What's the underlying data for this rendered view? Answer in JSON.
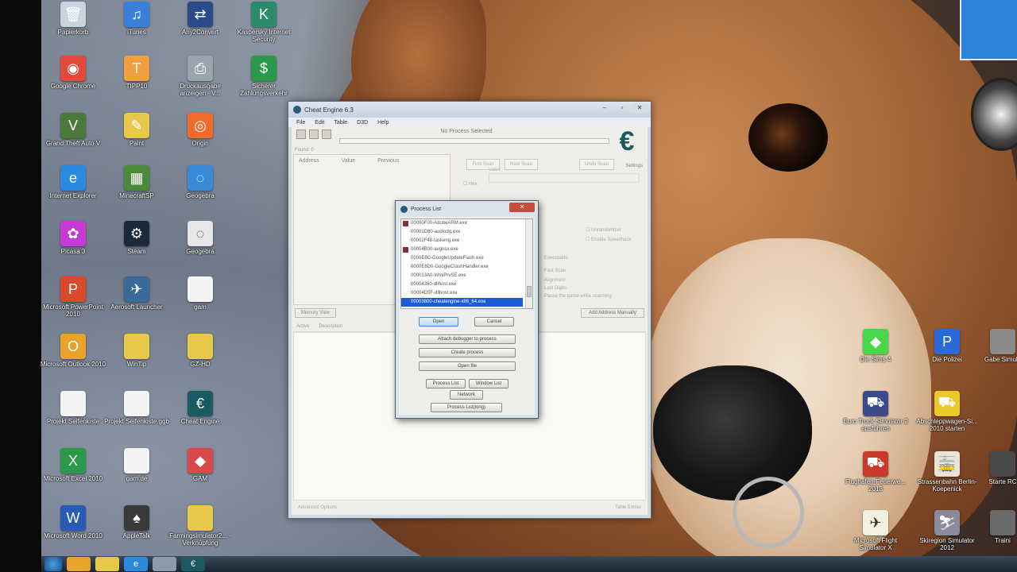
{
  "desktop_icons": [
    {
      "label": "Papierkorb",
      "icon": "recycle-bin-icon",
      "color": "#c9d4de",
      "glyph": "🗑"
    },
    {
      "label": "iTunes",
      "icon": "itunes-icon",
      "color": "#3a7fd8",
      "glyph": "♫"
    },
    {
      "label": "Any2Convert",
      "icon": "converter-icon",
      "color": "#2a4a8a",
      "glyph": "⇄"
    },
    {
      "label": "Kaspersky Internet Security",
      "icon": "kaspersky-icon",
      "color": "#2a8a6a",
      "glyph": "K"
    },
    {
      "label": "Google Chrome",
      "icon": "chrome-icon",
      "color": "#e24a3a",
      "glyph": "◉"
    },
    {
      "label": "TIPP10",
      "icon": "tipp10-icon",
      "color": "#f0a040",
      "glyph": "T"
    },
    {
      "label": "Druckausgabe anzeigen - V...",
      "icon": "printer-icon",
      "color": "#9aa4ac",
      "glyph": "⎙"
    },
    {
      "label": "Sicherer Zahlungsverkehr",
      "icon": "secure-payment-icon",
      "color": "#2a9a4a",
      "glyph": "$"
    },
    {
      "label": "Grand Theft Auto V",
      "icon": "gta-icon",
      "color": "#4a7a3a",
      "glyph": "V"
    },
    {
      "label": "Paint",
      "icon": "paint-icon",
      "color": "#e8c84a",
      "glyph": "✎"
    },
    {
      "label": "Origin",
      "icon": "origin-icon",
      "color": "#f06a2a",
      "glyph": "◎"
    },
    {
      "label": "Internet Explorer",
      "icon": "internet-explorer-icon",
      "color": "#2a8ae0",
      "glyph": "e"
    },
    {
      "label": "MinecraftSP",
      "icon": "minecraft-icon",
      "color": "#4a8a3a",
      "glyph": "▦"
    },
    {
      "label": "Geogebra",
      "icon": "geogebra-icon",
      "color": "#3a8ad8",
      "glyph": "◌"
    },
    {
      "label": "Picasa 3",
      "icon": "picasa-icon",
      "color": "#c83ad8",
      "glyph": "✿"
    },
    {
      "label": "Steam",
      "icon": "steam-icon",
      "color": "#1a2a3a",
      "glyph": "⚙"
    },
    {
      "label": "Geogebra",
      "icon": "geogebra-icon",
      "color": "#e8e8e8",
      "glyph": "◌"
    },
    {
      "label": "Microsoft PowerPoint 2010",
      "icon": "powerpoint-icon",
      "color": "#d84a2a",
      "glyph": "P"
    },
    {
      "label": "Aerosoft Launcher",
      "icon": "aerosoft-icon",
      "color": "#3a6a9a",
      "glyph": "✈"
    },
    {
      "label": "gam",
      "icon": "document-icon",
      "color": "#f4f4f4",
      "glyph": ""
    },
    {
      "label": "Microsoft Outlook 2010",
      "icon": "outlook-icon",
      "color": "#e8a42a",
      "glyph": "O"
    },
    {
      "label": "WinTip",
      "icon": "folder-icon",
      "color": "#e8c84a",
      "glyph": ""
    },
    {
      "label": "GZ-HD",
      "icon": "folder-icon",
      "color": "#e8c84a",
      "glyph": ""
    },
    {
      "label": "Projekt Seifenkiste",
      "icon": "document-icon",
      "color": "#f4f4f4",
      "glyph": ""
    },
    {
      "label": "Projekt Seifenkiste.ggb",
      "icon": "document-icon",
      "color": "#f4f4f4",
      "glyph": ""
    },
    {
      "label": "Cheat Engine",
      "icon": "cheat-engine-icon",
      "color": "#1a5a60",
      "glyph": "€"
    },
    {
      "label": "Microsoft Excel 2010",
      "icon": "excel-icon",
      "color": "#2a9a4a",
      "glyph": "X"
    },
    {
      "label": "gam.de",
      "icon": "document-icon",
      "color": "#f4f4f4",
      "glyph": ""
    },
    {
      "label": "GAM",
      "icon": "gam-icon",
      "color": "#d84a4a",
      "glyph": "◆"
    },
    {
      "label": "Microsoft Word 2010",
      "icon": "word-icon",
      "color": "#2a5ab8",
      "glyph": "W"
    },
    {
      "label": "AppleTalk",
      "icon": "apple-icon",
      "color": "#3a3a3a",
      "glyph": "♠"
    },
    {
      "label": "Farmingsimulator2... - Verknüpfung",
      "icon": "folder-icon",
      "color": "#e8c84a",
      "glyph": ""
    },
    {
      "label": "Die Sims 4",
      "icon": "sims-icon",
      "color": "#4ad84a",
      "glyph": "◆"
    },
    {
      "label": "Die Polizei",
      "icon": "police-icon",
      "color": "#2a6ad8",
      "glyph": "P"
    },
    {
      "label": "Gabe Simula",
      "icon": "game-icon",
      "color": "#8a8a8a",
      "glyph": ""
    },
    {
      "label": "Euro Truck Simulator 2 ausführen",
      "icon": "truck-icon",
      "color": "#3a4a8a",
      "glyph": "⛟"
    },
    {
      "label": "Abschleppwagen-Si... 2010 starten",
      "icon": "tow-truck-icon",
      "color": "#e8c82a",
      "glyph": "⛟"
    },
    {
      "label": "Flughafen-Feuerwe... 2013",
      "icon": "firetruck-icon",
      "color": "#c83a2a",
      "glyph": "⛟"
    },
    {
      "label": "Strassenbahn Berlin-Koepenick",
      "icon": "tram-icon",
      "color": "#e8e4d8",
      "glyph": "🚋"
    },
    {
      "label": "Starte RC",
      "icon": "game-icon",
      "color": "#4a4a4a",
      "glyph": ""
    },
    {
      "label": "Microsoft Flight Simulator X",
      "icon": "flight-sim-icon",
      "color": "#f4f0e0",
      "glyph": "✈"
    },
    {
      "label": "Skiregion Simulator 2012",
      "icon": "ski-icon",
      "color": "#8a8a9a",
      "glyph": "⛷"
    },
    {
      "label": "Traini",
      "icon": "game-icon",
      "color": "#6a6a6a",
      "glyph": ""
    }
  ],
  "cheat_engine": {
    "title": "Cheat Engine 6.3",
    "menu": [
      "File",
      "Edit",
      "Table",
      "D3D",
      "Help"
    ],
    "process_label": "No Process Selected",
    "found_label": "Found: 0",
    "columns": [
      "Address",
      "Value",
      "Previous"
    ],
    "first_scan": "First Scan",
    "next_scan": "Next Scan",
    "undo_scan": "Undo Scan",
    "settings": "Settings",
    "value_label": "Value:",
    "hex_label": "Hex",
    "options": [
      "Unrandomizer",
      "Enable Speedhack",
      "Executable",
      "Fast Scan",
      "Alignment",
      "Last Digits",
      "Pause the game while scanning"
    ],
    "memory_view": "Memory View",
    "add_address": "Add Address Manually",
    "lower_columns": [
      "Active",
      "Description"
    ],
    "advanced_options": "Advanced Options",
    "table_extras": "Table Extras"
  },
  "process_dialog": {
    "title": "Process List",
    "processes": [
      "00000F00-AdobeARM.exe",
      "00001D80-audiodg.exe",
      "00002F48-taskeng.exe",
      "00004B00-avgnsx.exe",
      "0000E8C-GoogleUpdateFlash.exe",
      "0000E8D0-GoogleCrashHandler.exe",
      "000013A0-WmiPrvSE.exe",
      "00004360-dllhost.exe",
      "00004D5F-dllhost.exe",
      "00003800-cheatengine-x86_64.exe"
    ],
    "selected_index": 9,
    "open": "Open",
    "cancel": "Cancel",
    "attach_debugger": "Attach debugger to process",
    "create_process": "Create process",
    "open_file": "Open file",
    "process_list": "Process List",
    "window_list": "Window List",
    "network": "Network",
    "process_list_long": "Process List(long)"
  }
}
